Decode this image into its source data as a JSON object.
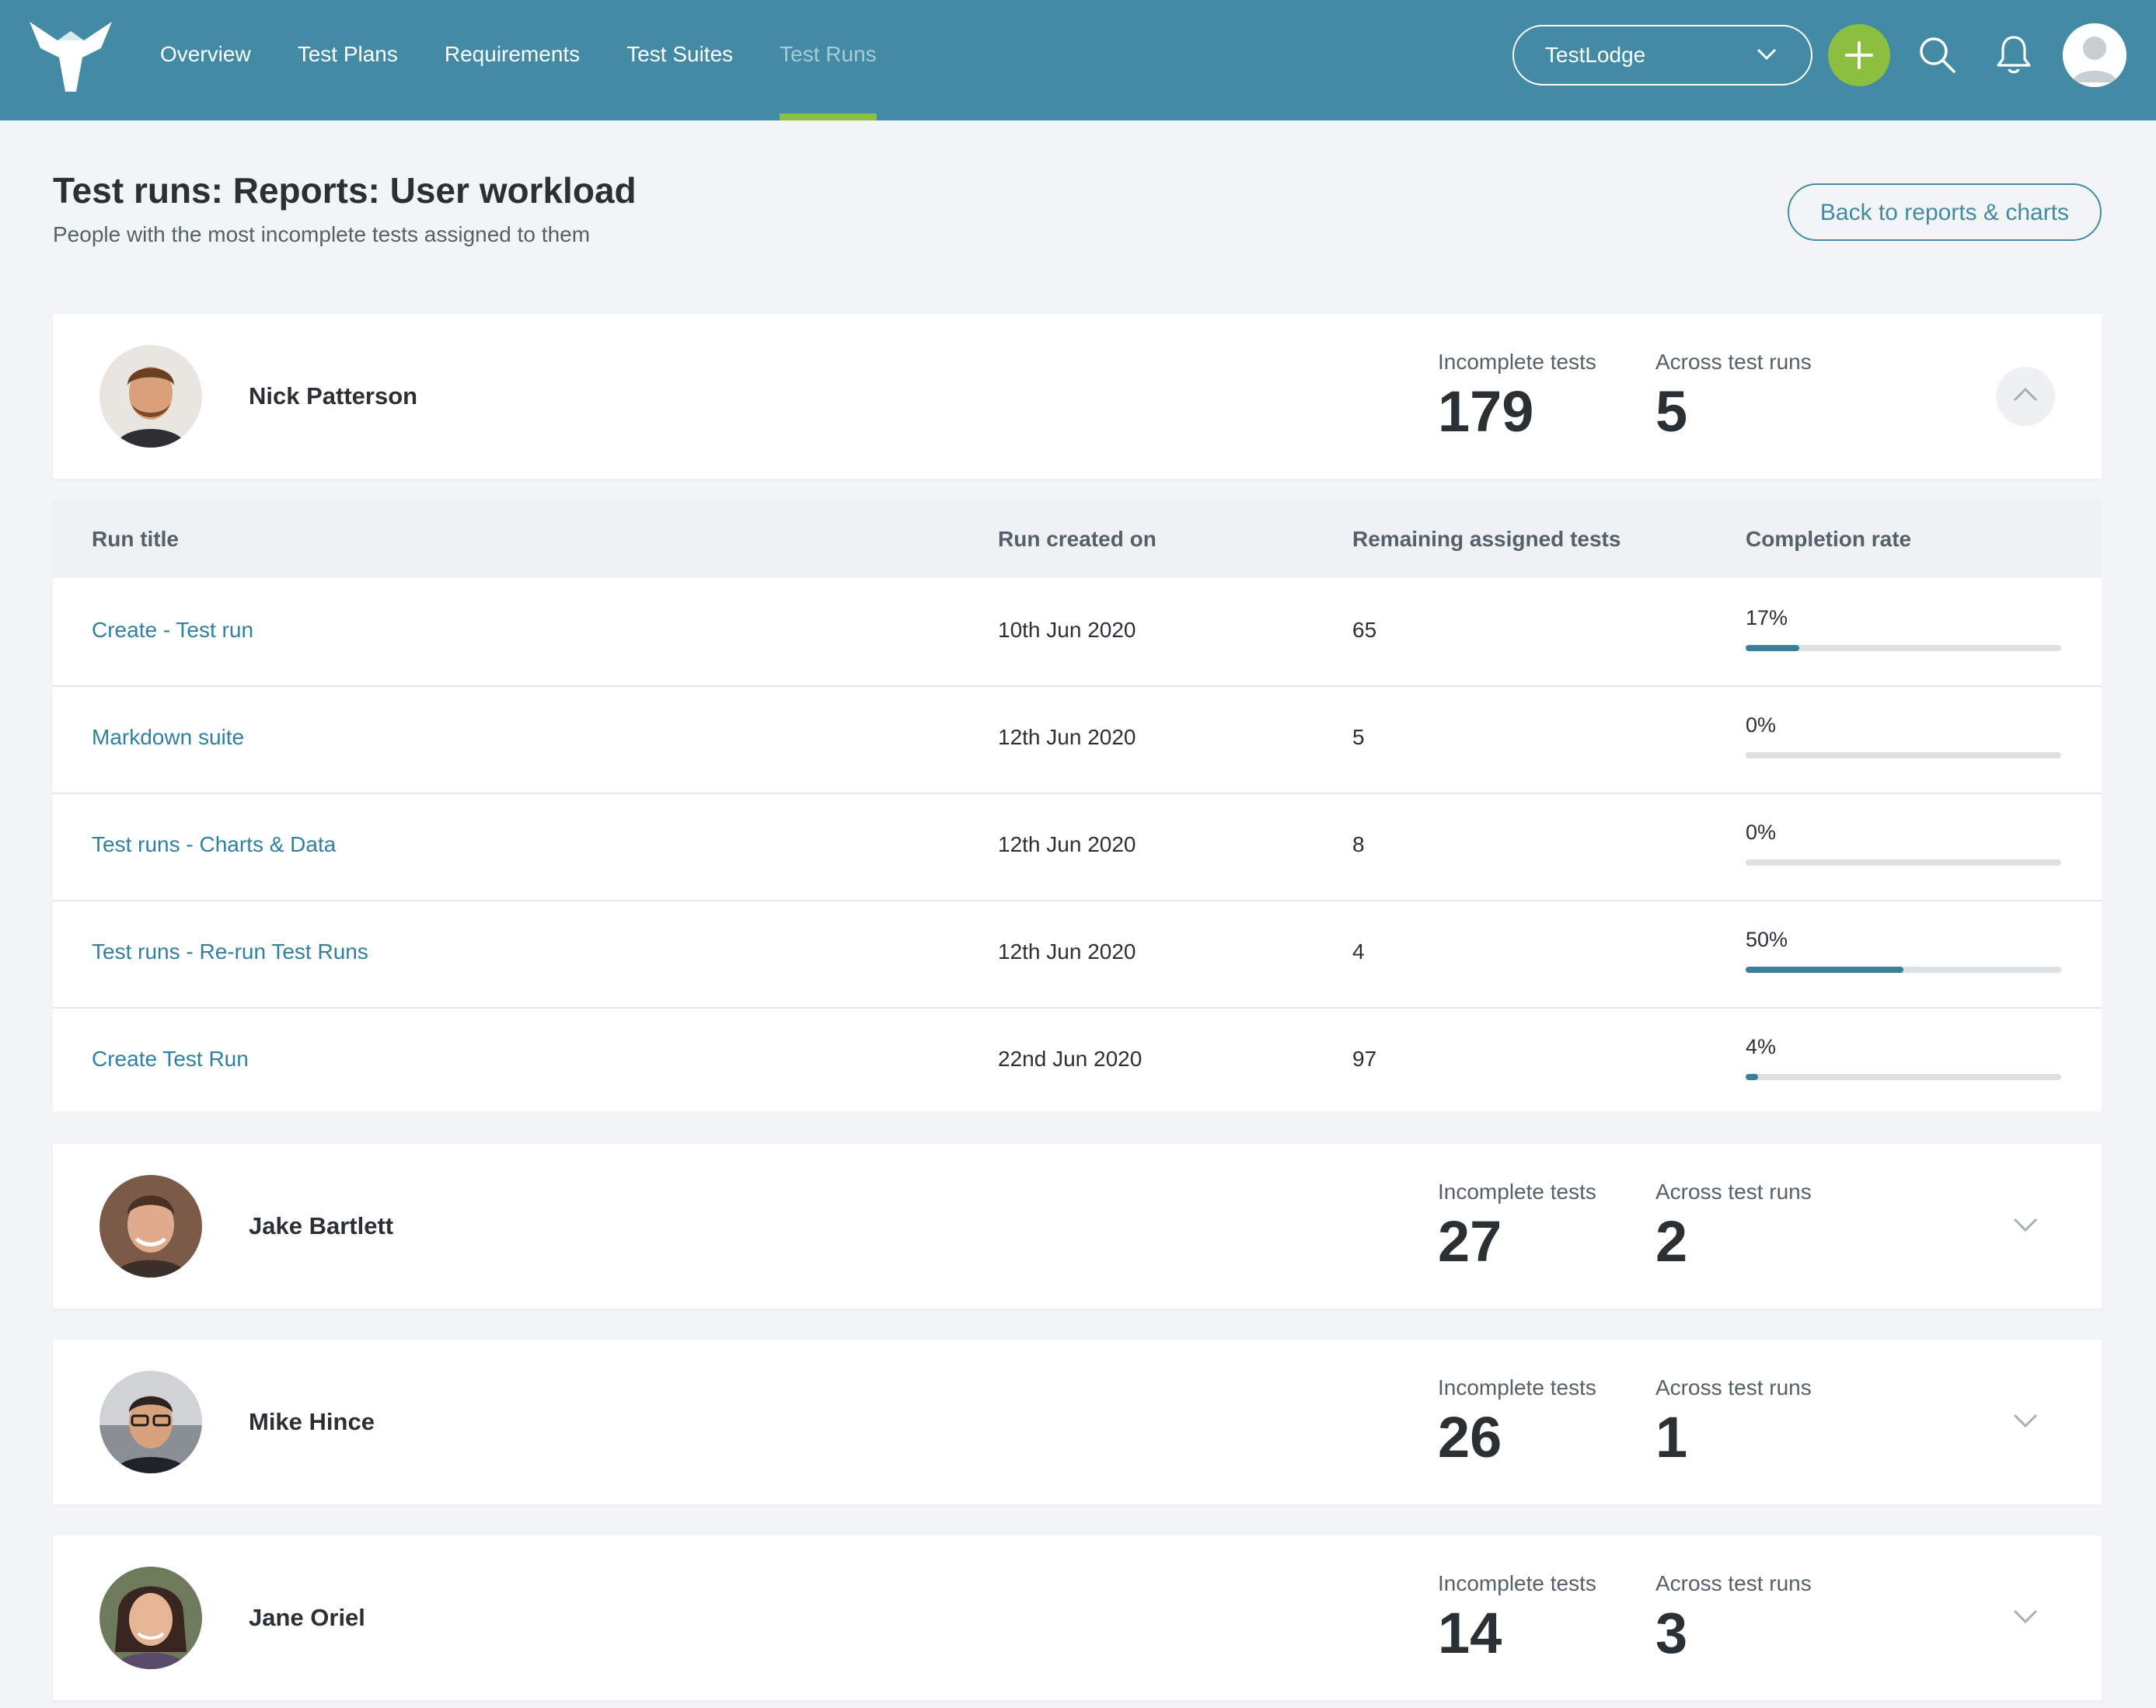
{
  "nav": {
    "items": [
      {
        "label": "Overview",
        "active": false
      },
      {
        "label": "Test Plans",
        "active": false
      },
      {
        "label": "Requirements",
        "active": false
      },
      {
        "label": "Test Suites",
        "active": false
      },
      {
        "label": "Test Runs",
        "active": true
      }
    ],
    "account_select": "TestLodge",
    "icons": {
      "logo": "testlodge-logo",
      "add": "plus-icon",
      "search": "search-icon",
      "notifications": "bell-icon",
      "avatar": "user-avatar-icon",
      "dropdown": "chevron-down-icon"
    }
  },
  "header": {
    "title": "Test runs: Reports: User workload",
    "subtitle": "People with the most incomplete tests assigned to them",
    "back_button": "Back to reports & charts"
  },
  "stat_labels": {
    "incomplete": "Incomplete tests",
    "across": "Across test runs"
  },
  "users": [
    {
      "name": "Nick Patterson",
      "incomplete": "179",
      "across": "5",
      "expanded": true
    },
    {
      "name": "Jake Bartlett",
      "incomplete": "27",
      "across": "2",
      "expanded": false
    },
    {
      "name": "Mike Hince",
      "incomplete": "26",
      "across": "1",
      "expanded": false
    },
    {
      "name": "Jane Oriel",
      "incomplete": "14",
      "across": "3",
      "expanded": false
    }
  ],
  "table": {
    "headers": [
      "Run title",
      "Run created on",
      "Remaining assigned tests",
      "Completion rate"
    ],
    "rows": [
      {
        "title": "Create - Test run",
        "created": "10th Jun 2020",
        "remaining": "65",
        "rate": "17%",
        "rate_value": 17
      },
      {
        "title": "Markdown suite",
        "created": "12th Jun 2020",
        "remaining": "5",
        "rate": "0%",
        "rate_value": 0
      },
      {
        "title": "Test runs - Charts & Data",
        "created": "12th Jun 2020",
        "remaining": "8",
        "rate": "0%",
        "rate_value": 0
      },
      {
        "title": "Test runs - Re-run Test Runs",
        "created": "12th Jun 2020",
        "remaining": "4",
        "rate": "50%",
        "rate_value": 50
      },
      {
        "title": "Create Test Run",
        "created": "22nd Jun 2020",
        "remaining": "97",
        "rate": "4%",
        "rate_value": 4
      }
    ]
  },
  "colors": {
    "header_bg": "#438aa5",
    "accent_green": "#8cbf3f",
    "link": "#2f81a1",
    "progress_fill": "#3b7f9a"
  }
}
